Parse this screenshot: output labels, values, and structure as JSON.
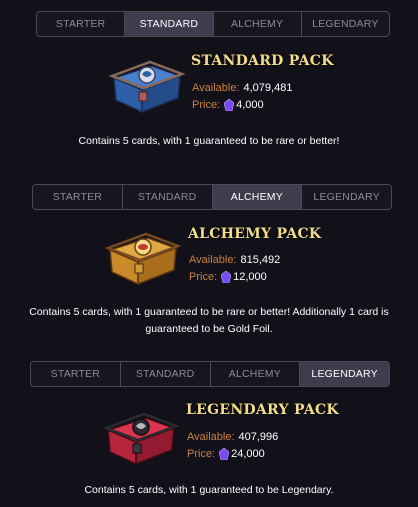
{
  "sections": [
    {
      "tabs": [
        "STARTER",
        "STANDARD",
        "ALCHEMY",
        "LEGENDARY"
      ],
      "active_tab": 1,
      "title": "STANDARD PACK",
      "available_label": "Available:",
      "available_value": "4,079,481",
      "price_label": "Price:",
      "price_value": "4,000",
      "description": "Contains 5 cards, with 1 guaranteed to be rare or better!"
    },
    {
      "tabs": [
        "STARTER",
        "STANDARD",
        "ALCHEMY",
        "LEGENDARY"
      ],
      "active_tab": 2,
      "title": "ALCHEMY PACK",
      "available_label": "Available:",
      "available_value": "815,492",
      "price_label": "Price:",
      "price_value": "12,000",
      "description": "Contains 5 cards, with 1 guaranteed to be rare or better! Additionally 1 card is guaranteed to be Gold Foil."
    },
    {
      "tabs": [
        "STARTER",
        "STANDARD",
        "ALCHEMY",
        "LEGENDARY"
      ],
      "active_tab": 3,
      "title": "LEGENDARY PACK",
      "available_label": "Available:",
      "available_value": "407,996",
      "price_label": "Price:",
      "price_value": "24,000",
      "description": "Contains 5 cards, with 1 guaranteed to be Legendary."
    }
  ],
  "colors": {
    "background": "#12111a",
    "title_gold": "#f2dc8a",
    "label_orange": "#c9823f",
    "standard_chest": "#2f5fa8",
    "alchemy_chest": "#c98a2a",
    "legendary_chest": "#b8243e",
    "gem_purple": "#7a4cf0"
  },
  "icons": {
    "chest": "treasure-chest-icon",
    "currency": "purple-gem-icon"
  }
}
